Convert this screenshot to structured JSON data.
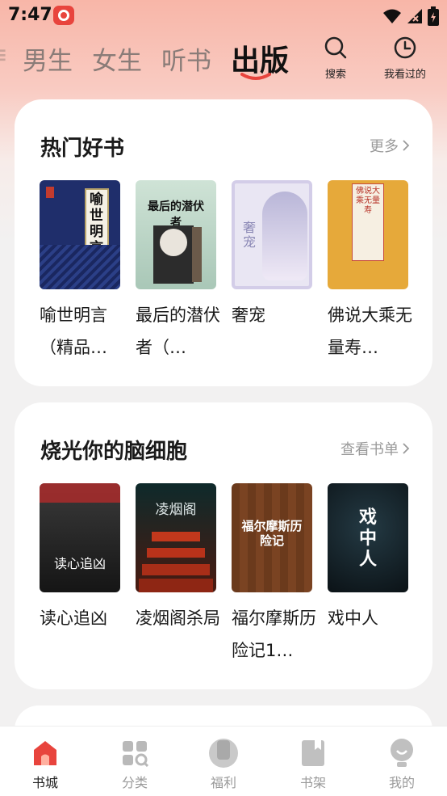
{
  "status": {
    "time": "7:47"
  },
  "top_tabs": [
    {
      "label": "男生",
      "active": false
    },
    {
      "label": "女生",
      "active": false
    },
    {
      "label": "听书",
      "active": false
    },
    {
      "label": "出版",
      "active": true
    }
  ],
  "top_actions": {
    "search": "搜索",
    "history": "我看过的"
  },
  "sections": [
    {
      "title": "热门好书",
      "more": "更多",
      "books": [
        {
          "title": "喻世明言（精品…",
          "cover_text": "喻世明言"
        },
        {
          "title": "最后的潜伏者（…",
          "cover_text": "最后的潜伏者"
        },
        {
          "title": "奢宠",
          "cover_text": "奢宠"
        },
        {
          "title": "佛说大乘无量寿…",
          "cover_text": "佛说大乘无量寿"
        }
      ]
    },
    {
      "title": "烧光你的脑细胞",
      "more": "查看书单",
      "books": [
        {
          "title": "读心追凶",
          "cover_text": "读心追凶"
        },
        {
          "title": "凌烟阁杀局",
          "cover_text": "凌烟阁"
        },
        {
          "title": "福尔摩斯历险记1…",
          "cover_text": "福尔摩斯历险记"
        },
        {
          "title": "戏中人",
          "cover_text": "戏中人"
        }
      ]
    }
  ],
  "bottom_nav": [
    {
      "label": "书城",
      "icon": "bookstore-icon",
      "active": true
    },
    {
      "label": "分类",
      "icon": "category-icon",
      "active": false
    },
    {
      "label": "福利",
      "icon": "welfare-icon",
      "active": false
    },
    {
      "label": "书架",
      "icon": "bookshelf-icon",
      "active": false
    },
    {
      "label": "我的",
      "icon": "profile-icon",
      "active": false
    }
  ],
  "colors": {
    "accent": "#e8443d",
    "inactive": "#9a9a9a"
  }
}
